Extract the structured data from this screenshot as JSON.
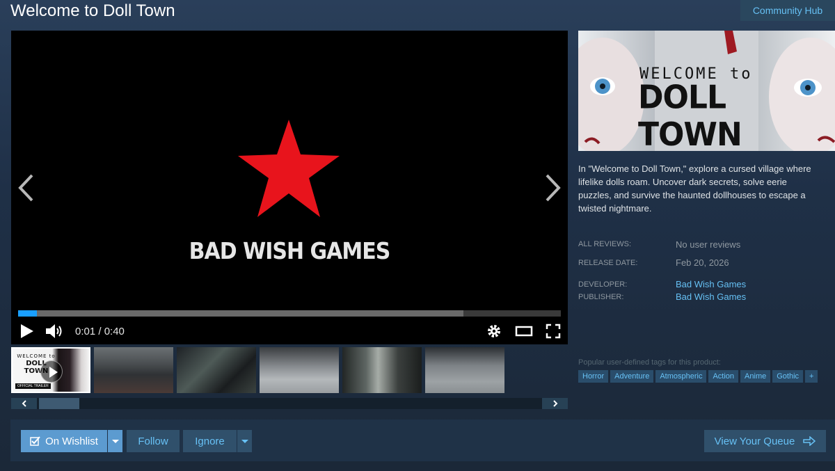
{
  "header": {
    "title": "Welcome to Doll Town",
    "community_hub": "Community Hub"
  },
  "video": {
    "studio_name": "BAD WISH GAMES",
    "time_current": "0:01",
    "time_total": "0:40",
    "time_display": "0:01 / 0:40",
    "played_fraction": 0.034,
    "buffered_fraction": 0.82
  },
  "capsule": {
    "line1": "WELCOME to",
    "line2": "DOLL TOWN"
  },
  "thumbnails": {
    "first_logo_line1": "WELCOME to",
    "first_logo_line2": "DOLL TOWN",
    "first_badge": "OFFICIAL TRAILER"
  },
  "description": "In \"Welcome to Doll Town,\" explore a cursed village where lifelike dolls roam. Uncover dark secrets, solve eerie puzzles, and survive the haunted dollhouses to escape a twisted nightmare.",
  "meta": {
    "reviews_label": "ALL REVIEWS:",
    "reviews_value": "No user reviews",
    "release_label": "RELEASE DATE:",
    "release_value": "Feb 20, 2026",
    "developer_label": "DEVELOPER:",
    "developer_value": "Bad Wish Games",
    "publisher_label": "PUBLISHER:",
    "publisher_value": "Bad Wish Games"
  },
  "tags": {
    "label": "Popular user-defined tags for this product:",
    "items": [
      "Horror",
      "Adventure",
      "Atmospheric",
      "Action",
      "Anime",
      "Gothic",
      "+"
    ]
  },
  "actions": {
    "wishlist": "On Wishlist",
    "follow": "Follow",
    "ignore": "Ignore",
    "queue": "View Your Queue"
  },
  "colors": {
    "accent": "#66c0f4",
    "star": "#e8141c",
    "progress": "#1a9fff"
  }
}
